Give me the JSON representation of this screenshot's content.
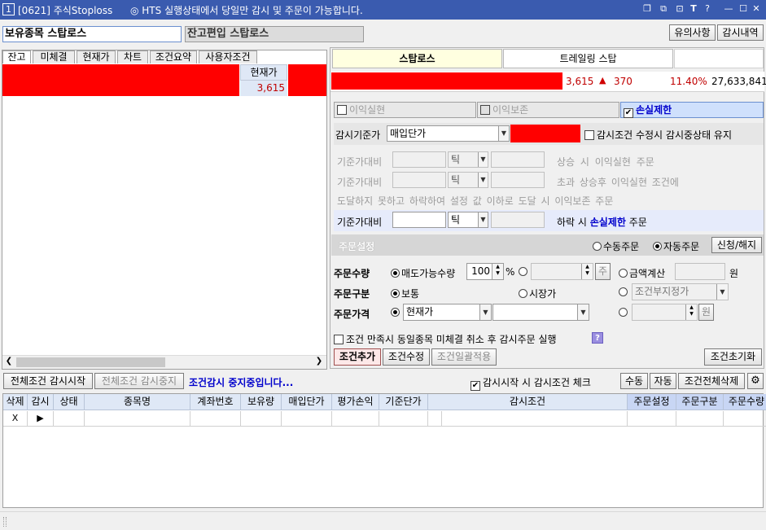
{
  "window": {
    "screen_no": "1",
    "title": "[0621] 주식Stoploss",
    "message": "◎ HTS 실행상태에서 당일만 감시 및 주문이 가능합니다.",
    "icons": [
      "restore-icon",
      "copy-icon",
      "lock-icon",
      "font-icon",
      "help-icon",
      "minimize-icon",
      "maximize-icon",
      "close-icon"
    ]
  },
  "top": {
    "tab_holding": "보유종목 스탑로스",
    "tab_balance": "잔고편입 스탑로스",
    "btn_notice": "유의사항",
    "btn_history": "감시내역"
  },
  "left": {
    "tabs": [
      "잔고",
      "미체결",
      "현재가",
      "차트",
      "조건요약",
      "사용자조건"
    ],
    "col_price": "현재가",
    "price_value": "3,615"
  },
  "right": {
    "tabs": [
      "스탑로스",
      "트레일링 스탑"
    ],
    "quote": {
      "price": "3,615",
      "arrow": "▲",
      "change": "370",
      "rate": "11.40%",
      "volume": "27,633,841"
    },
    "cond_tabs": [
      "이익실현",
      "이익보존",
      "손실제한"
    ],
    "base_label": "감시기준가",
    "base_value": "매입단가",
    "keep_label": "감시조건 수정시 감시중상태 유지",
    "row1": {
      "label": "기준가대비",
      "unit": "틱",
      "text": "상승 시  이익실현  주문"
    },
    "row2": {
      "label": "기준가대비",
      "unit": "틱",
      "text": "초과 상승후 이익실현 조건에"
    },
    "row3": {
      "text": "도달하지 못하고 하락하여 설정 값 이하로 도달 시  이익보존 주문"
    },
    "row4": {
      "label": "기준가대비",
      "unit": "틱",
      "text_pre": "하락 시",
      "text_bold": "손실제한",
      "text_post": "주문"
    },
    "order_header": "주문설정",
    "manual": "수동주문",
    "auto": "자동주문",
    "apply_btn": "신청/해지",
    "qty_label": "주문수량",
    "qty_opt": "매도가능수량",
    "qty_value": "100",
    "qty_unit": "%",
    "qty_ju": "주",
    "amount_opt": "금액계산",
    "amount_unit": "원",
    "type_label": "주문구분",
    "type_normal": "보통",
    "type_market": "시장가",
    "type_cond": "조건부지정가",
    "price_label": "주문가격",
    "price_opt": "현재가",
    "price_unit": "원",
    "cancel_check": "조건 만족시 동일종목 미체결 취소 후 감시주문 실행",
    "help": "?",
    "btn_add": "조건추가",
    "btn_modify": "조건수정",
    "btn_bulk": "조건일괄적용",
    "btn_reset": "조건초기화"
  },
  "bottom": {
    "btn_start_all": "전체조건 감시시작",
    "btn_stop_all": "전체조건 감시중지",
    "status": "조건감시 중지중입니다...",
    "check_start": "감시시작 시 감시조건 체크",
    "btn_manual": "수동",
    "btn_auto": "자동",
    "btn_delete_all": "조건전체삭제",
    "columns": [
      "삭제",
      "감시",
      "상태",
      "종목명",
      "계좌번호",
      "보유량",
      "매입단가",
      "평가손익",
      "기준단가",
      "감시조건",
      "주문설정",
      "주문구분",
      "주문수량"
    ],
    "row": {
      "delete": "X",
      "watch": "▶"
    }
  },
  "colors": {
    "titlebar": "#3a5baf",
    "red": "#ff0000",
    "accent_blue": "#0000cc",
    "highlight": "#e6ebfb"
  }
}
